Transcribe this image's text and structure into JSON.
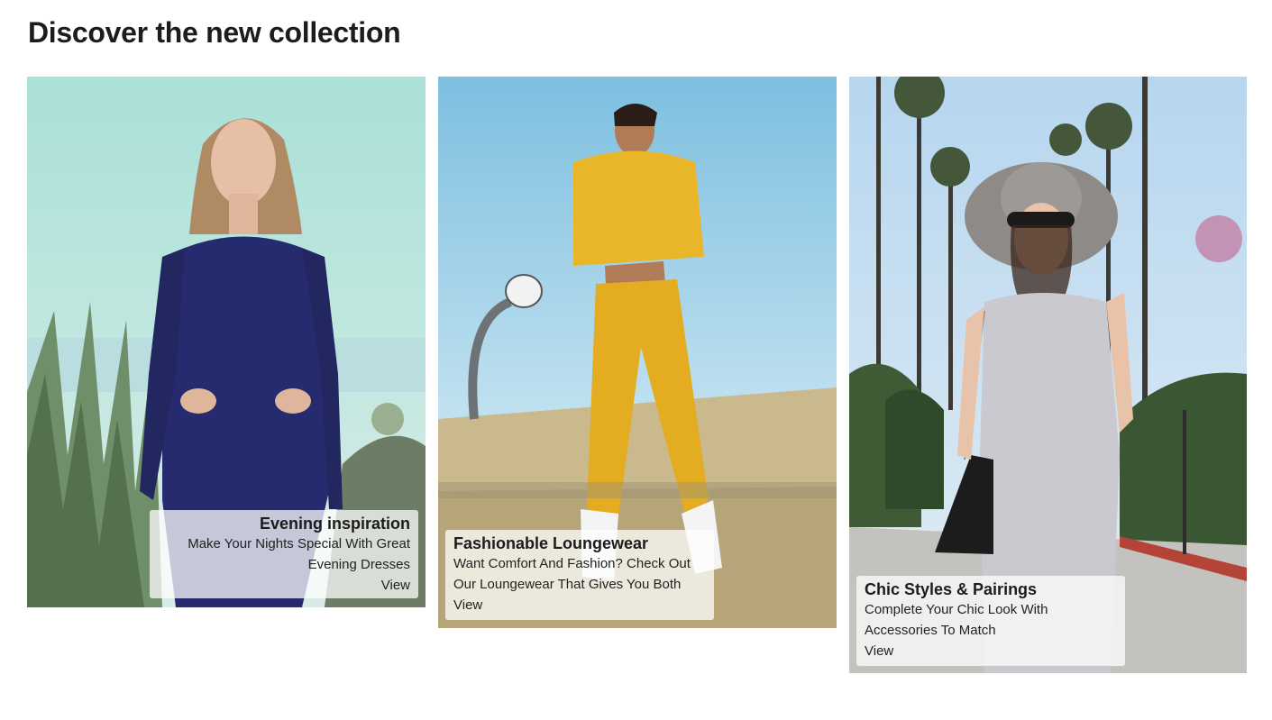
{
  "page": {
    "title": "Discover the new collection"
  },
  "cards": [
    {
      "title": "Evening inspiration",
      "text": "Make Your Nights Special With Great Evening Dresses",
      "link": "View",
      "image_alt": "Model in a navy crochet cut-out evening dress by the sea"
    },
    {
      "title": "Fashionable Loungewear",
      "text": "Want Comfort And Fashion? Check Out Our Loungewear That Gives You Both",
      "link": "View",
      "image_alt": "Model in a yellow hoodie and joggers on a basketball court"
    },
    {
      "title": "Chic Styles & Pairings",
      "text": "Complete Your Chic Look With Accessories To Match",
      "link": "View",
      "image_alt": "Model in a gray dress and wide-brim hat on a palm-lined street"
    }
  ],
  "colors": {
    "caption_bg": "#ffffffbd",
    "dress_navy": "#262a6e",
    "loungewear_yellow": "#e9b62a",
    "dress_gray": "#c9c9cf"
  }
}
